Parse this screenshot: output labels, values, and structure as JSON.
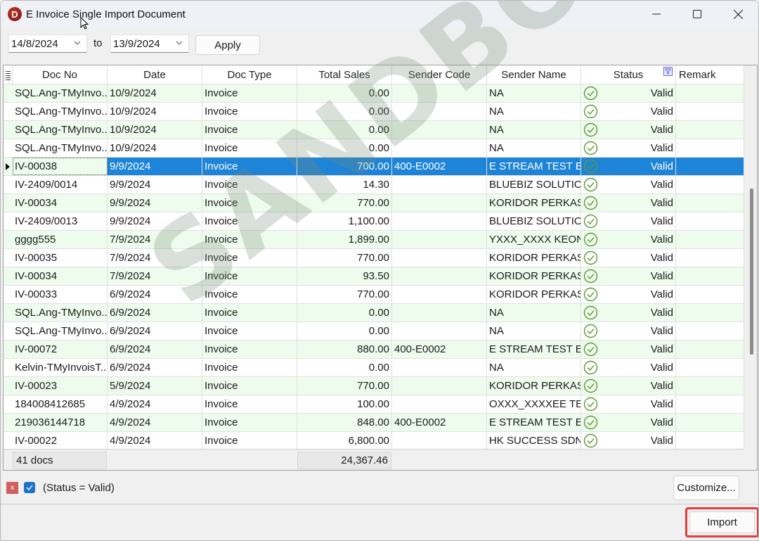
{
  "window": {
    "title": "E Invoice Single Import Document",
    "app_icon_letter": "D",
    "controls": [
      "minimize",
      "maximize",
      "close"
    ]
  },
  "toolbar": {
    "date_from": "14/8/2024",
    "to_label": "to",
    "date_to": "13/9/2024",
    "apply_label": "Apply"
  },
  "grid": {
    "columns": [
      "Doc No",
      "Date",
      "Doc Type",
      "Total Sales",
      "Sender Code",
      "Sender Name",
      "Status",
      "Remark"
    ],
    "rows": [
      {
        "doc_no": "SQL.Ang-TMyInvo...",
        "date": "10/9/2024",
        "doc_type": "Invoice",
        "total_sales": "0.00",
        "sender_code": "",
        "sender_name": "NA",
        "status": "Valid",
        "remark": ""
      },
      {
        "doc_no": "SQL.Ang-TMyInvo...",
        "date": "10/9/2024",
        "doc_type": "Invoice",
        "total_sales": "0.00",
        "sender_code": "",
        "sender_name": "NA",
        "status": "Valid",
        "remark": ""
      },
      {
        "doc_no": "SQL.Ang-TMyInvo...",
        "date": "10/9/2024",
        "doc_type": "Invoice",
        "total_sales": "0.00",
        "sender_code": "",
        "sender_name": "NA",
        "status": "Valid",
        "remark": ""
      },
      {
        "doc_no": "SQL.Ang-TMyInvo...",
        "date": "10/9/2024",
        "doc_type": "Invoice",
        "total_sales": "0.00",
        "sender_code": "",
        "sender_name": "NA",
        "status": "Valid",
        "remark": ""
      },
      {
        "doc_no": "IV-00038",
        "date": "9/9/2024",
        "doc_type": "Invoice",
        "total_sales": "700.00",
        "sender_code": "400-E0002",
        "sender_name": "E STREAM TEST E...",
        "status": "Valid",
        "remark": "",
        "selected": true
      },
      {
        "doc_no": "IV-2409/0014",
        "date": "9/9/2024",
        "doc_type": "Invoice",
        "total_sales": "14.30",
        "sender_code": "",
        "sender_name": "BLUEBIZ SOLUTIO...",
        "status": "Valid",
        "remark": ""
      },
      {
        "doc_no": "IV-00034",
        "date": "9/9/2024",
        "doc_type": "Invoice",
        "total_sales": "770.00",
        "sender_code": "",
        "sender_name": "KORIDOR PERKAS...",
        "status": "Valid",
        "remark": ""
      },
      {
        "doc_no": "IV-2409/0013",
        "date": "9/9/2024",
        "doc_type": "Invoice",
        "total_sales": "1,100.00",
        "sender_code": "",
        "sender_name": "BLUEBIZ SOLUTIO...",
        "status": "Valid",
        "remark": ""
      },
      {
        "doc_no": "gggg555",
        "date": "7/9/2024",
        "doc_type": "Invoice",
        "total_sales": "1,899.00",
        "sender_code": "",
        "sender_name": "YXXX_XXXX KEON...",
        "status": "Valid",
        "remark": ""
      },
      {
        "doc_no": "IV-00035",
        "date": "7/9/2024",
        "doc_type": "Invoice",
        "total_sales": "770.00",
        "sender_code": "",
        "sender_name": "KORIDOR PERKAS...",
        "status": "Valid",
        "remark": ""
      },
      {
        "doc_no": "IV-00034",
        "date": "7/9/2024",
        "doc_type": "Invoice",
        "total_sales": "93.50",
        "sender_code": "",
        "sender_name": "KORIDOR PERKAS...",
        "status": "Valid",
        "remark": ""
      },
      {
        "doc_no": "IV-00033",
        "date": "6/9/2024",
        "doc_type": "Invoice",
        "total_sales": "770.00",
        "sender_code": "",
        "sender_name": "KORIDOR PERKAS...",
        "status": "Valid",
        "remark": ""
      },
      {
        "doc_no": "SQL.Ang-TMyInvo...",
        "date": "6/9/2024",
        "doc_type": "Invoice",
        "total_sales": "0.00",
        "sender_code": "",
        "sender_name": "NA",
        "status": "Valid",
        "remark": ""
      },
      {
        "doc_no": "SQL.Ang-TMyInvo...",
        "date": "6/9/2024",
        "doc_type": "Invoice",
        "total_sales": "0.00",
        "sender_code": "",
        "sender_name": "NA",
        "status": "Valid",
        "remark": ""
      },
      {
        "doc_no": "IV-00072",
        "date": "6/9/2024",
        "doc_type": "Invoice",
        "total_sales": "880.00",
        "sender_code": "400-E0002",
        "sender_name": "E STREAM TEST E...",
        "status": "Valid",
        "remark": ""
      },
      {
        "doc_no": "Kelvin-TMyInvoisT...",
        "date": "6/9/2024",
        "doc_type": "Invoice",
        "total_sales": "0.00",
        "sender_code": "",
        "sender_name": "NA",
        "status": "Valid",
        "remark": ""
      },
      {
        "doc_no": "IV-00023",
        "date": "5/9/2024",
        "doc_type": "Invoice",
        "total_sales": "770.00",
        "sender_code": "",
        "sender_name": "KORIDOR PERKAS...",
        "status": "Valid",
        "remark": ""
      },
      {
        "doc_no": "184008412685",
        "date": "4/9/2024",
        "doc_type": "Invoice",
        "total_sales": "100.00",
        "sender_code": "",
        "sender_name": "OXXX_XXXXEE TEE",
        "status": "Valid",
        "remark": ""
      },
      {
        "doc_no": "219036144718",
        "date": "4/9/2024",
        "doc_type": "Invoice",
        "total_sales": "848.00",
        "sender_code": "400-E0002",
        "sender_name": "E STREAM TEST E...",
        "status": "Valid",
        "remark": ""
      },
      {
        "doc_no": "IV-00022",
        "date": "4/9/2024",
        "doc_type": "Invoice",
        "total_sales": "6,800.00",
        "sender_code": "",
        "sender_name": "HK SUCCESS SDN...",
        "status": "Valid",
        "remark": ""
      }
    ],
    "footer": {
      "count": "41 docs",
      "total_sales": "24,367.46"
    }
  },
  "filter": {
    "text": "(Status = Valid)",
    "enabled": true,
    "customize_label": "Customize..."
  },
  "actions": {
    "import_label": "Import"
  },
  "watermark": "SANDBOX",
  "colors": {
    "selection": "#1e84d8",
    "alt_row": "#eefcee",
    "valid_icon": "#5a9a2e",
    "highlight_border": "#e03c3c"
  }
}
